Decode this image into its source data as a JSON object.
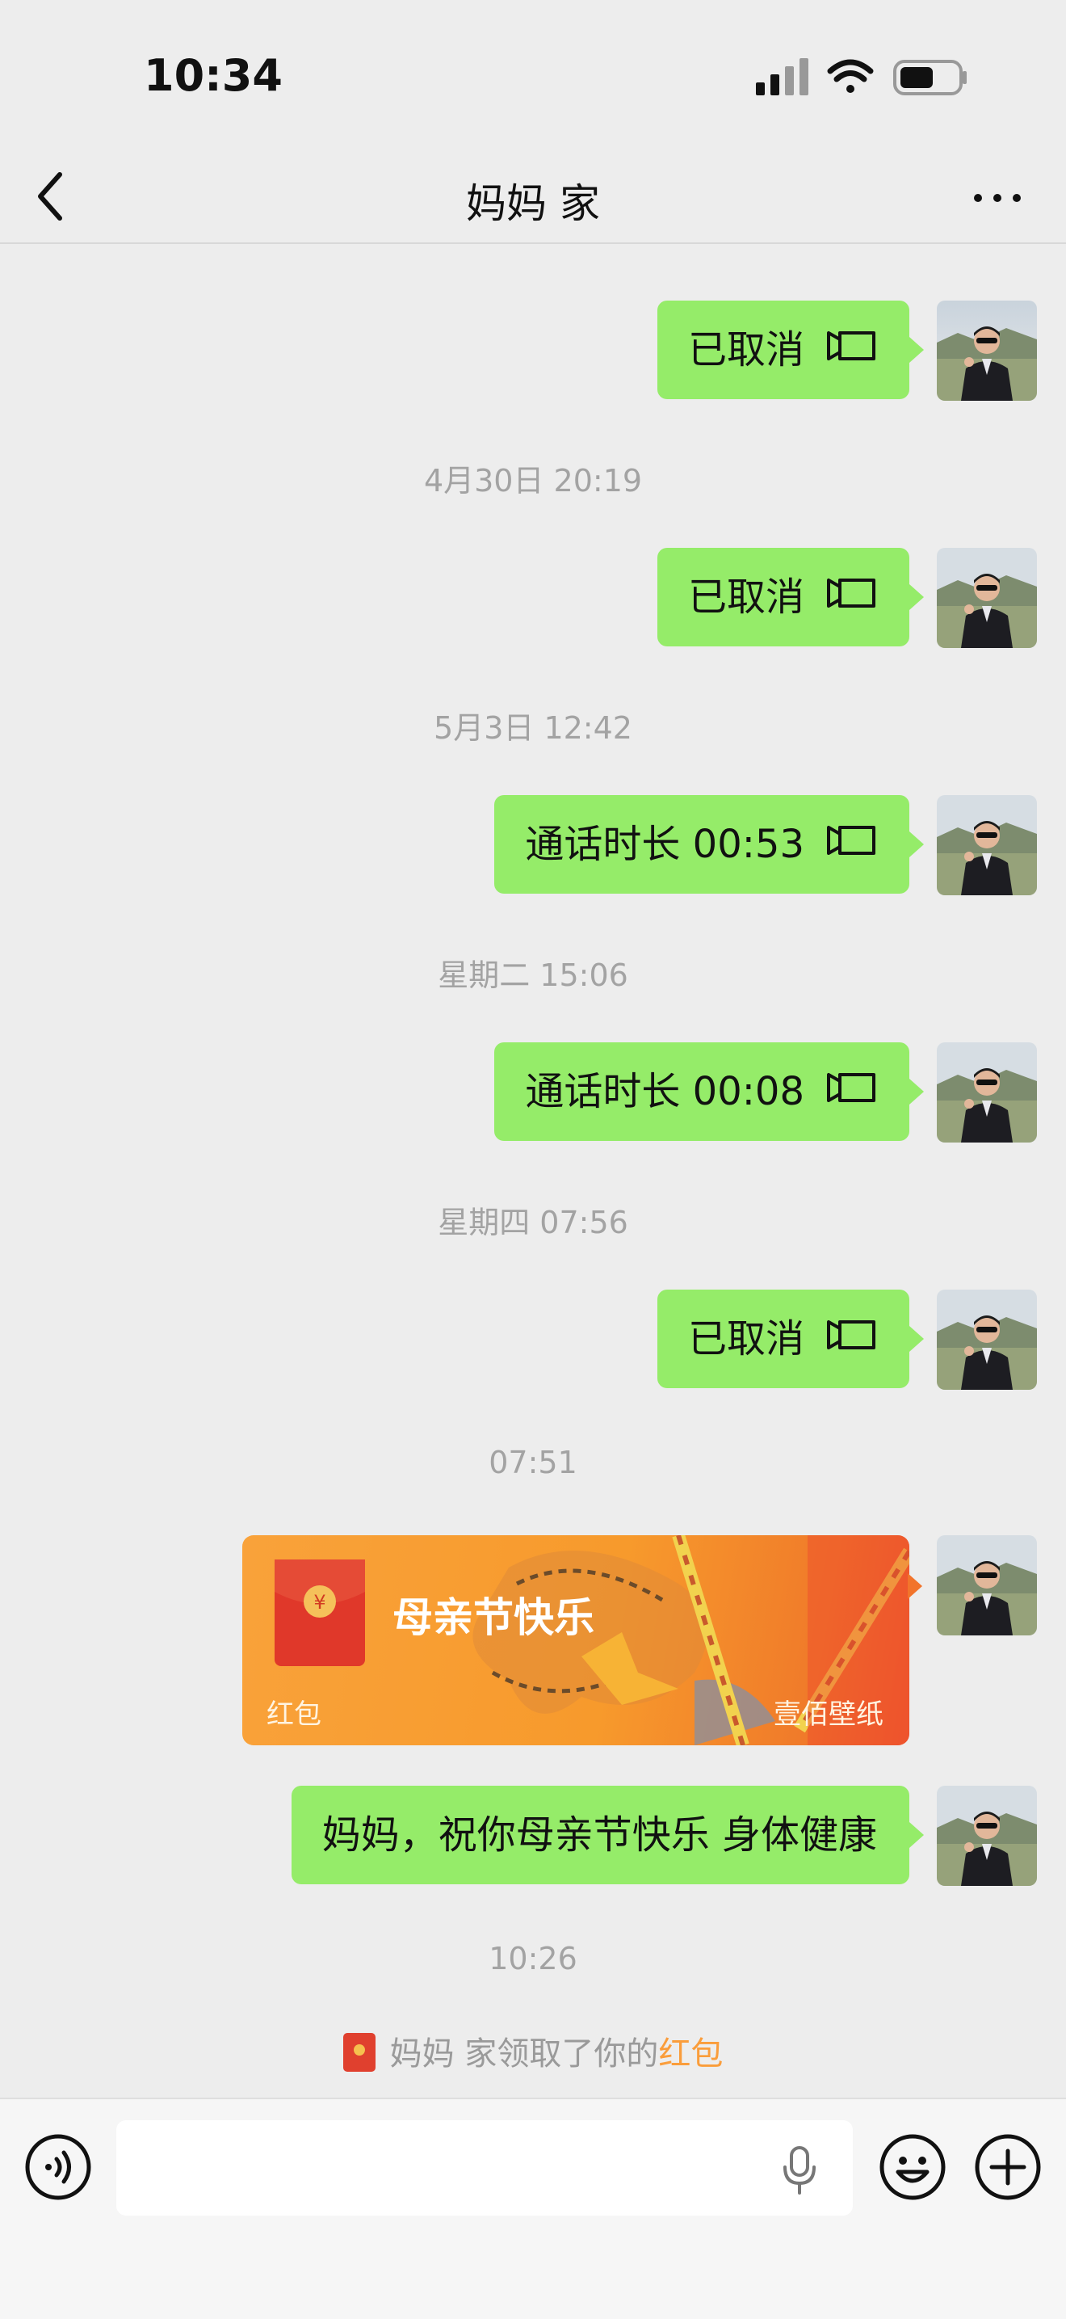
{
  "status_bar": {
    "time": "10:34"
  },
  "nav": {
    "title": "妈妈 家"
  },
  "messages": [
    {
      "timestamp": "4月30日 20:19",
      "text": "已取消"
    },
    {
      "timestamp": "5月3日 12:42",
      "text": "通话时长 00:53"
    },
    {
      "timestamp": "星期二 15:06",
      "text": "通话时长 00:08"
    },
    {
      "timestamp": "星期四 07:56",
      "text": "已取消"
    },
    {
      "timestamp": "07:51"
    }
  ],
  "top_partial_message": {
    "text": "已取消"
  },
  "red_packet": {
    "title": "母亲节快乐",
    "label": "红包",
    "watermark": "壹佰壁纸"
  },
  "text_message": {
    "text": "妈妈，祝你母亲节快乐 身体健康"
  },
  "last_timestamp": "10:26",
  "notice": {
    "prefix": "妈妈 家领取了你的",
    "link": "红包"
  },
  "colors": {
    "bubble": "#95ec69",
    "background": "#ededed",
    "link": "#fa9d3b"
  }
}
